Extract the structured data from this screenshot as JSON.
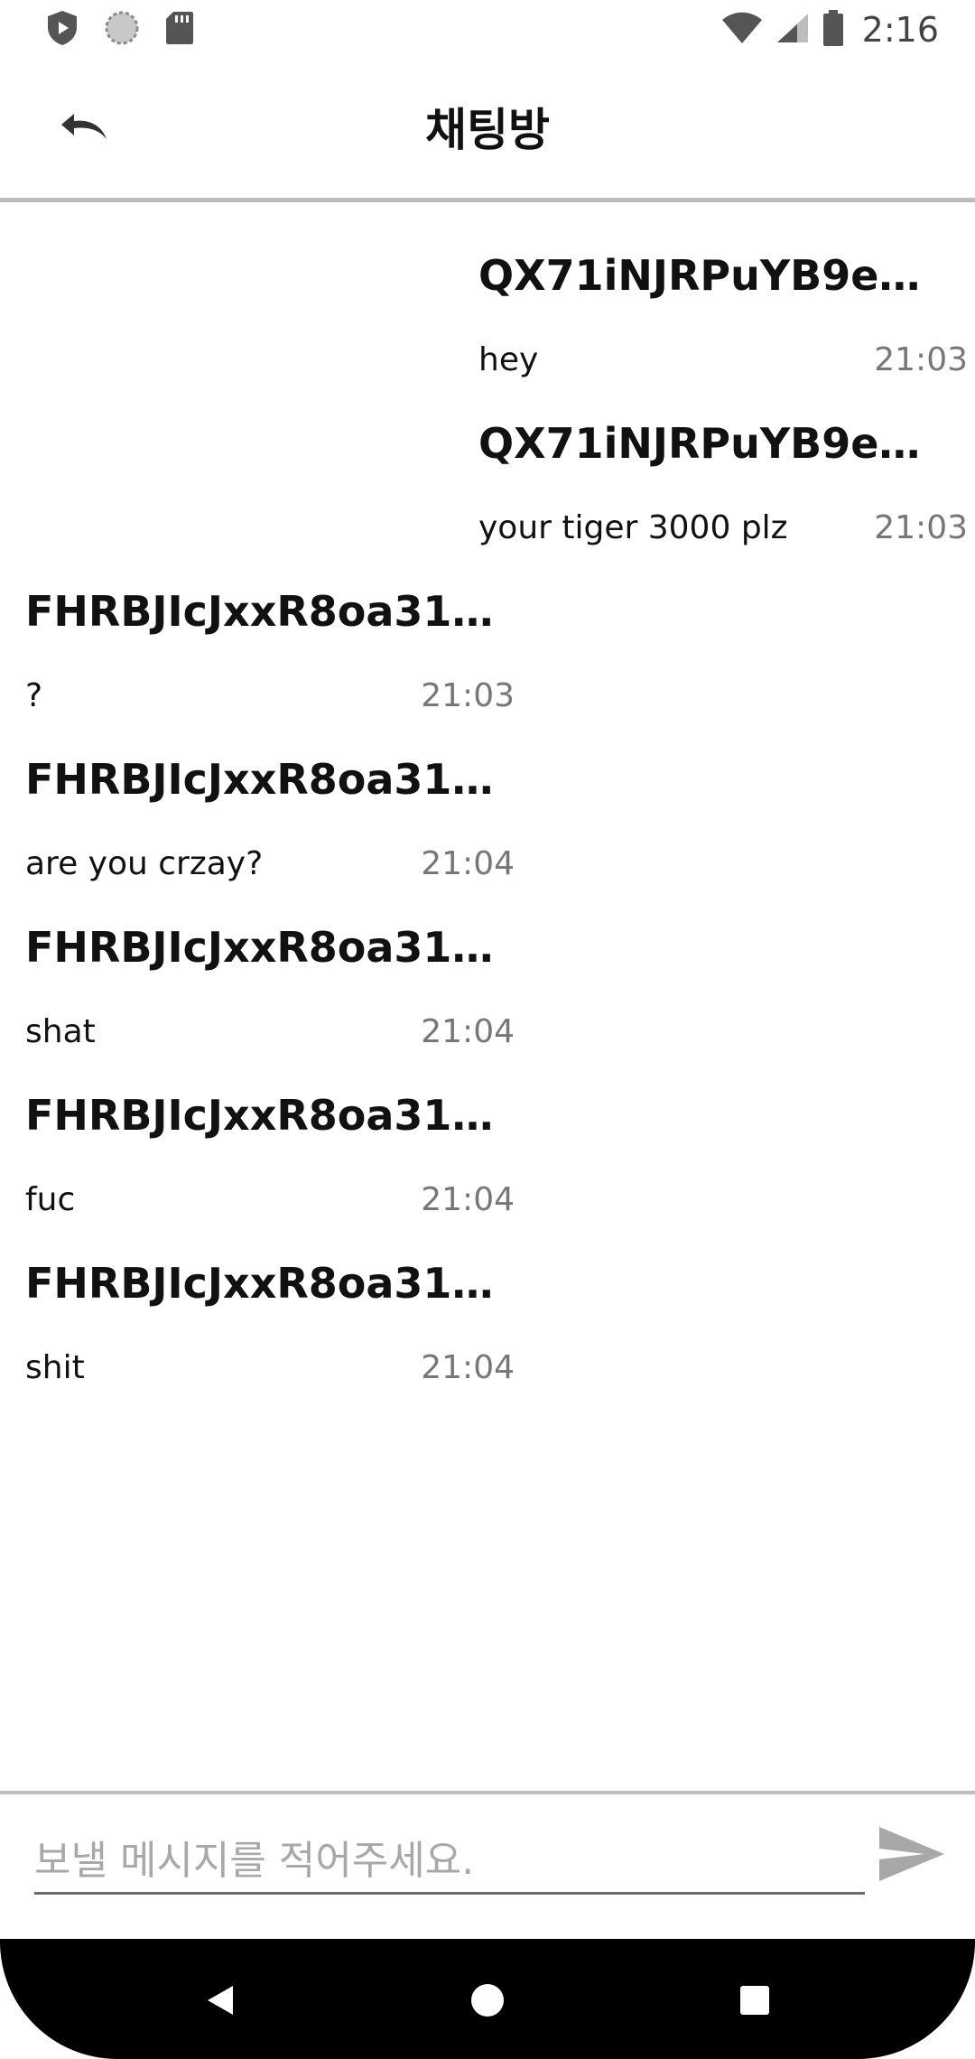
{
  "status_bar": {
    "time": "2:16",
    "left_icons": [
      "shield-icon",
      "loading-icon",
      "sd-card-icon"
    ],
    "right_icons": [
      "wifi-icon",
      "signal-icon",
      "battery-icon"
    ]
  },
  "header": {
    "title": "채팅방",
    "back_icon": "undo-arrow-icon"
  },
  "messages": [
    {
      "direction": "outgoing",
      "sender": "QX71iNJRPuYB9e…",
      "text": "hey",
      "time": "21:03"
    },
    {
      "direction": "outgoing",
      "sender": "QX71iNJRPuYB9e…",
      "text": "your tiger 3000 plz",
      "time": "21:03"
    },
    {
      "direction": "incoming",
      "sender": "FHRBJIcJxxR8oa31…",
      "text": "?",
      "time": "21:03"
    },
    {
      "direction": "incoming",
      "sender": "FHRBJIcJxxR8oa31…",
      "text": "are you crzay?",
      "time": "21:04"
    },
    {
      "direction": "incoming",
      "sender": "FHRBJIcJxxR8oa31…",
      "text": "shat",
      "time": "21:04"
    },
    {
      "direction": "incoming",
      "sender": "FHRBJIcJxxR8oa31…",
      "text": "fuc",
      "time": "21:04"
    },
    {
      "direction": "incoming",
      "sender": "FHRBJIcJxxR8oa31…",
      "text": "shit",
      "time": "21:04"
    }
  ],
  "composer": {
    "placeholder": "보낼 메시지를 적어주세요.",
    "value": "",
    "send_icon": "send-icon"
  },
  "nav_bar": {
    "icons": [
      "back-triangle-icon",
      "home-circle-icon",
      "recents-square-icon"
    ]
  },
  "colors": {
    "divider": "#bdbdbd",
    "timestamp": "#777777",
    "placeholder": "#a8a8a8",
    "nav_background": "#000000"
  }
}
